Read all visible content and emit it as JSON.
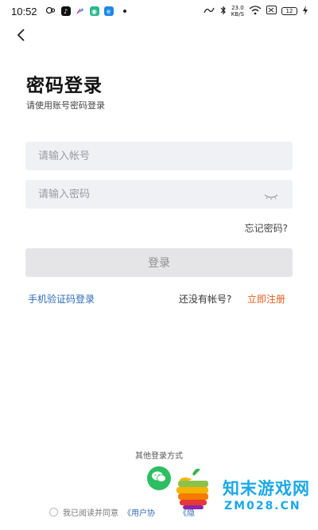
{
  "status_bar": {
    "time": "10:52",
    "net_speed_value": "23.0",
    "net_speed_unit": "KB/S",
    "battery": "12"
  },
  "header": {
    "title": "密码登录",
    "subtitle": "请使用账号密码登录"
  },
  "form": {
    "account_placeholder": "请输入帐号",
    "account_value": "",
    "password_placeholder": "请输入密码",
    "password_value": "",
    "forgot_label": "忘记密码?",
    "login_label": "登录"
  },
  "links": {
    "sms_login": "手机验证码登录",
    "no_account": "还没有帐号?",
    "register": "立即注册"
  },
  "other_login": {
    "title": "其他登录方式"
  },
  "agreement": {
    "prefix": "我已阅读并同意",
    "user_agreement": "《用户协",
    "privacy": "《隐"
  },
  "watermark": {
    "name": "知末游戏网",
    "site": "ZM028.CN"
  },
  "colors": {
    "link_blue": "#2f6cb5",
    "register_orange": "#e25c1f",
    "wechat_green": "#2dbe60",
    "watermark_blue": "#1aa8e8"
  }
}
